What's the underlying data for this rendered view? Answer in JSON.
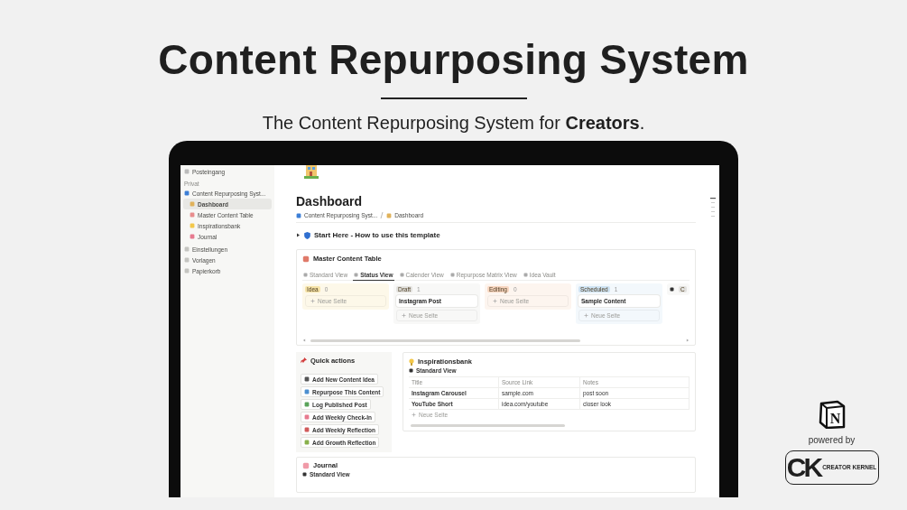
{
  "header": {
    "title": "Content Repurposing System",
    "subtitle": "The Content Repurposing System for **Creators**."
  },
  "sidebar": {
    "top_items": [
      {
        "label": "Posteingang"
      }
    ],
    "section": "Privat",
    "workspace": {
      "label": "Content Repurposing Syst...",
      "children": [
        {
          "label": "Dashboard",
          "selected": true
        },
        {
          "label": "Master Content Table",
          "selected": false
        },
        {
          "label": "Inspirationsbank",
          "selected": false
        },
        {
          "label": "Journal",
          "selected": false
        }
      ]
    },
    "bottom_items": [
      {
        "label": "Einstellungen"
      },
      {
        "label": "Vorlagen"
      },
      {
        "label": "Papierkorb"
      }
    ]
  },
  "page": {
    "title": "Dashboard",
    "breadcrumb": [
      "Content Repurposing Syst...",
      "Dashboard"
    ],
    "toggle": {
      "label": "Start Here - How to use this template",
      "expanded": false
    },
    "master_table": {
      "title": "Master Content Table",
      "tabs": [
        {
          "label": "Standard View",
          "selected": false
        },
        {
          "label": "Status View",
          "selected": true
        },
        {
          "label": "Calender View",
          "selected": false
        },
        {
          "label": "Repurpose Matrix View",
          "selected": false
        },
        {
          "label": "Idea Vault",
          "selected": false
        }
      ],
      "groups": [
        {
          "label": "Idea",
          "count": "0",
          "color": "#f6e3a8",
          "new_label": "Neue Seite"
        },
        {
          "label": "Draft",
          "count": "1",
          "color": "#e3e2df",
          "cards": [
            "Instagram Post"
          ],
          "new_label": "Neue Seite"
        },
        {
          "label": "Editing",
          "count": "0",
          "color": "#f8d6c0",
          "new_label": "Neue Seite"
        },
        {
          "label": "Scheduled",
          "count": "1",
          "color": "#cfe3f3",
          "cards": [
            "Sample Content"
          ],
          "new_label": "Neue Seite"
        },
        {
          "label": "C",
          "color": "#e3e2df"
        }
      ]
    },
    "quick_actions": {
      "title": "Quick actions",
      "buttons": [
        "Add New Content Idea",
        "Repurpose This Content",
        "Log Published Post",
        "Add Weekly Check-In",
        "Add Weekly Reflection",
        "Add Growth Reflection"
      ]
    },
    "inspirationsbank": {
      "title": "Inspirationsbank",
      "view": "Standard View",
      "columns": [
        "Title",
        "Source Link",
        "Notes"
      ],
      "rows": [
        [
          "Instagram Carousel",
          "sample.com",
          "post soon"
        ],
        [
          "YouTube Short",
          "idea.com/youtube",
          "closer look"
        ]
      ],
      "new_label": "Neue Seite"
    },
    "journal": {
      "title": "Journal",
      "view": "Standard View"
    }
  },
  "branding": {
    "notion_letter": "N",
    "powered_by": "powered by",
    "logo_letters": "CK",
    "logo_name": "CREATOR KERNEL"
  }
}
